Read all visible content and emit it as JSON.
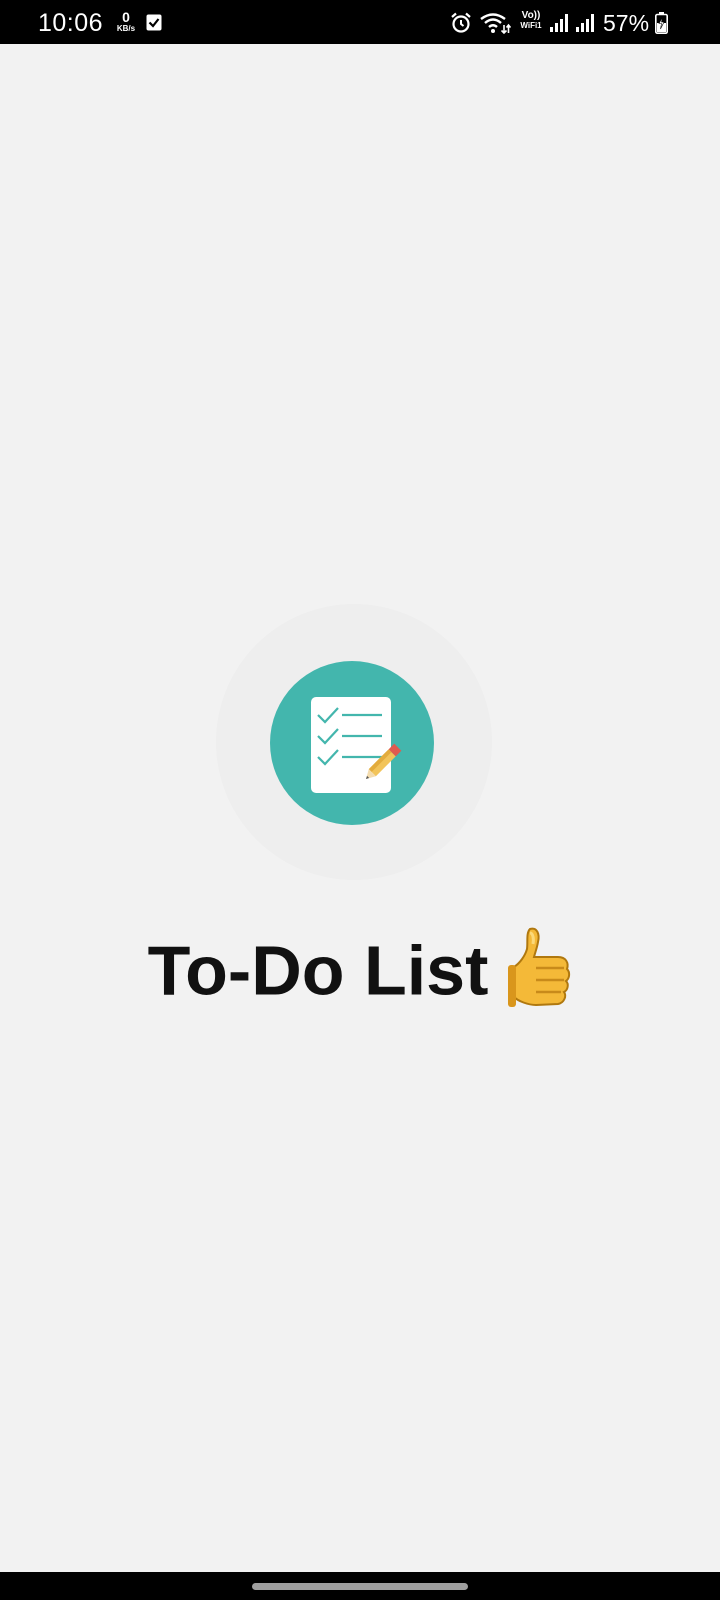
{
  "status_bar": {
    "time": "10:06",
    "net_speed_value": "0",
    "net_speed_unit": "KB/s",
    "volte_label": "Vo))",
    "wifi_label": "WiFi1",
    "battery_percent": "57%",
    "icons": [
      "checkbox-notification-icon",
      "alarm-icon",
      "wifi-icon",
      "signal-icon",
      "signal-icon",
      "battery-charging-icon"
    ]
  },
  "splash": {
    "logo_icon": "checklist-pencil-icon",
    "title": "To-Do List",
    "title_emoji": "thumbs-up-icon",
    "colors": {
      "logo_circle": "#43b6ad",
      "halo": "#eeeeee",
      "background": "#f2f2f2",
      "title_text": "#111111"
    }
  },
  "nav_bar": {
    "icon": "gesture-handle"
  }
}
